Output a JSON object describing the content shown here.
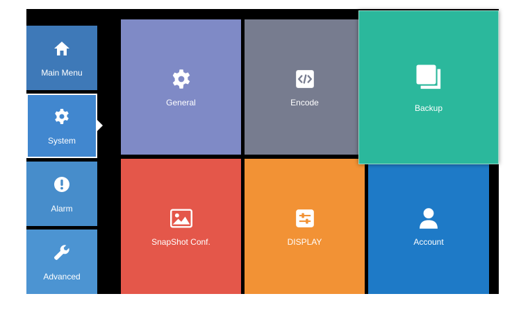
{
  "sidebar": {
    "items": [
      {
        "name": "main-menu",
        "label": "Main Menu",
        "icon": "home-icon",
        "color": "#3e79b8",
        "selected": false
      },
      {
        "name": "system",
        "label": "System",
        "icon": "gear-icon",
        "color": "#4187cf",
        "selected": true
      },
      {
        "name": "alarm",
        "label": "Alarm",
        "icon": "alert-icon",
        "color": "#478dcb",
        "selected": false
      },
      {
        "name": "advanced",
        "label": "Advanced",
        "icon": "wrench-icon",
        "color": "#4c94d2",
        "selected": false
      }
    ]
  },
  "tiles": [
    {
      "name": "general",
      "label": "General",
      "icon": "gear-icon",
      "color": "#7f8ac6"
    },
    {
      "name": "encode",
      "label": "Encode",
      "icon": "code-icon",
      "color": "#777c8f"
    },
    {
      "name": "backup",
      "label": "Backup",
      "icon": "copy-icon",
      "color": "#2bb89c"
    },
    {
      "name": "snapshot-conf",
      "label": "SnapShot Conf.",
      "icon": "image-icon",
      "color": "#e4574a"
    },
    {
      "name": "display",
      "label": "DISPLAY",
      "icon": "sliders-icon",
      "color": "#f29235"
    },
    {
      "name": "account",
      "label": "Account",
      "icon": "user-icon",
      "color": "#1e7ac7"
    }
  ]
}
